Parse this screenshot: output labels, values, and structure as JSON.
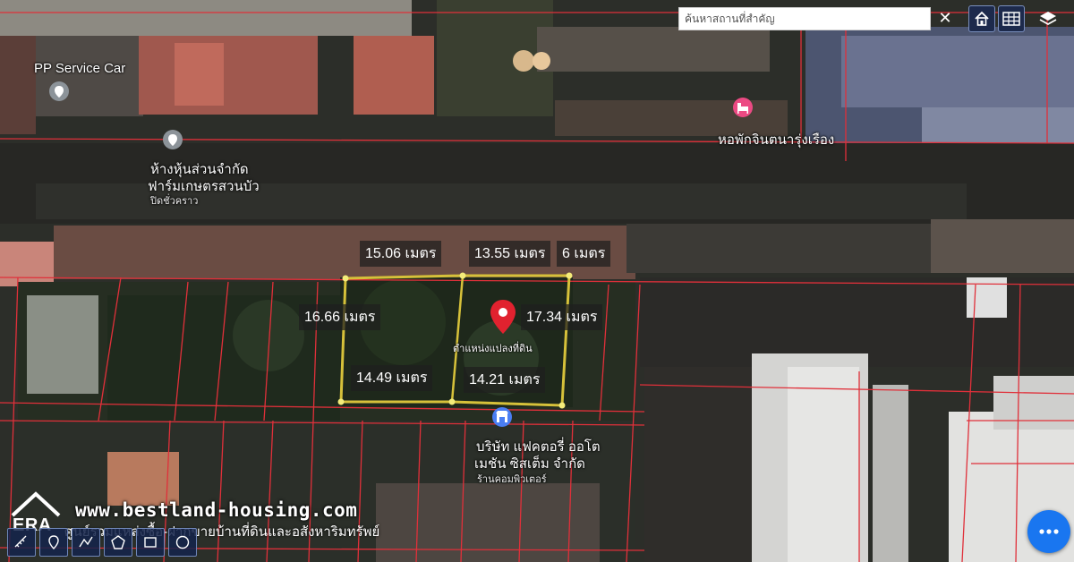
{
  "search": {
    "placeholder": "ค้นหาสถานที่สำคัญ",
    "value": ""
  },
  "toolbar": {
    "clear_label": "✕"
  },
  "pois": {
    "pp_service": "PP Service Car",
    "farm_line1": "ห้างหุ้นส่วนจำกัด",
    "farm_line2": "ฟาร์มเกษตรสวนบัว",
    "farm_sub": "ปิดชั่วคราว",
    "dorm": "หอพักจินตนารุ่งเรือง",
    "company_line1": "บริษัท แฟคตอรี่ ออโต",
    "company_line2": "เมชัน ซิสเต็ม จำกัด",
    "company_sub": "ร้านคอมพิวเตอร์"
  },
  "parcel": {
    "caption": "ตำแหน่งแปลงที่ดิน",
    "measurements": {
      "top_left": "15.06 เมตร",
      "top_right": "13.55 เมตร",
      "top_right_partial": "6 เมตร",
      "left": "16.66 เมตร",
      "right": "17.34 เมตร",
      "bottom_left": "14.49 เมตร",
      "bottom_right": "14.21 เมตร"
    }
  },
  "watermark": {
    "brand": "ERA",
    "url": "www.bestland-housing.com",
    "tagline": "ศูนย์รวมแหล่งซื้อ-ฝากขายบ้านที่ดินและอสังหาริมทรัพย์"
  },
  "colors": {
    "parcel_outline": "#d6c13a",
    "boundary_lines": "#e0303a",
    "pin": "#e1222f",
    "poi_gray": "#8c9399",
    "poi_pink": "#ec4a83",
    "poi_blue": "#4a7ef3",
    "fab": "#1976f0"
  },
  "icons": {
    "pin": "location-pin-icon",
    "home": "home-icon",
    "grid": "grid-icon",
    "layers": "layers-icon",
    "bed": "bed-icon",
    "store": "store-icon",
    "more": "more-dots-icon"
  }
}
